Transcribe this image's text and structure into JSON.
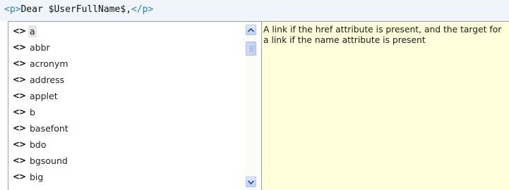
{
  "editor": {
    "open_tag": "<p>",
    "text": "Dear $UserFullName$,",
    "close_tag": "</p>"
  },
  "completion": {
    "tag_icon": "<>",
    "items": [
      {
        "label": "a",
        "selected": true
      },
      {
        "label": "abbr"
      },
      {
        "label": "acronym"
      },
      {
        "label": "address"
      },
      {
        "label": "applet"
      },
      {
        "label": "b"
      },
      {
        "label": "basefont"
      },
      {
        "label": "bdo"
      },
      {
        "label": "bgsound"
      },
      {
        "label": "big"
      }
    ],
    "description": "A link if the href attribute is present, and the target for a link if the name attribute is present",
    "icons": {
      "scroll_up": "chevron-up-icon",
      "scroll_down": "chevron-down-icon",
      "tag": "html-tag-icon"
    },
    "colors": {
      "tag_color": "#2f7fb8",
      "description_background": "#ffffdc",
      "selection_background": "#e5e5e5"
    }
  }
}
